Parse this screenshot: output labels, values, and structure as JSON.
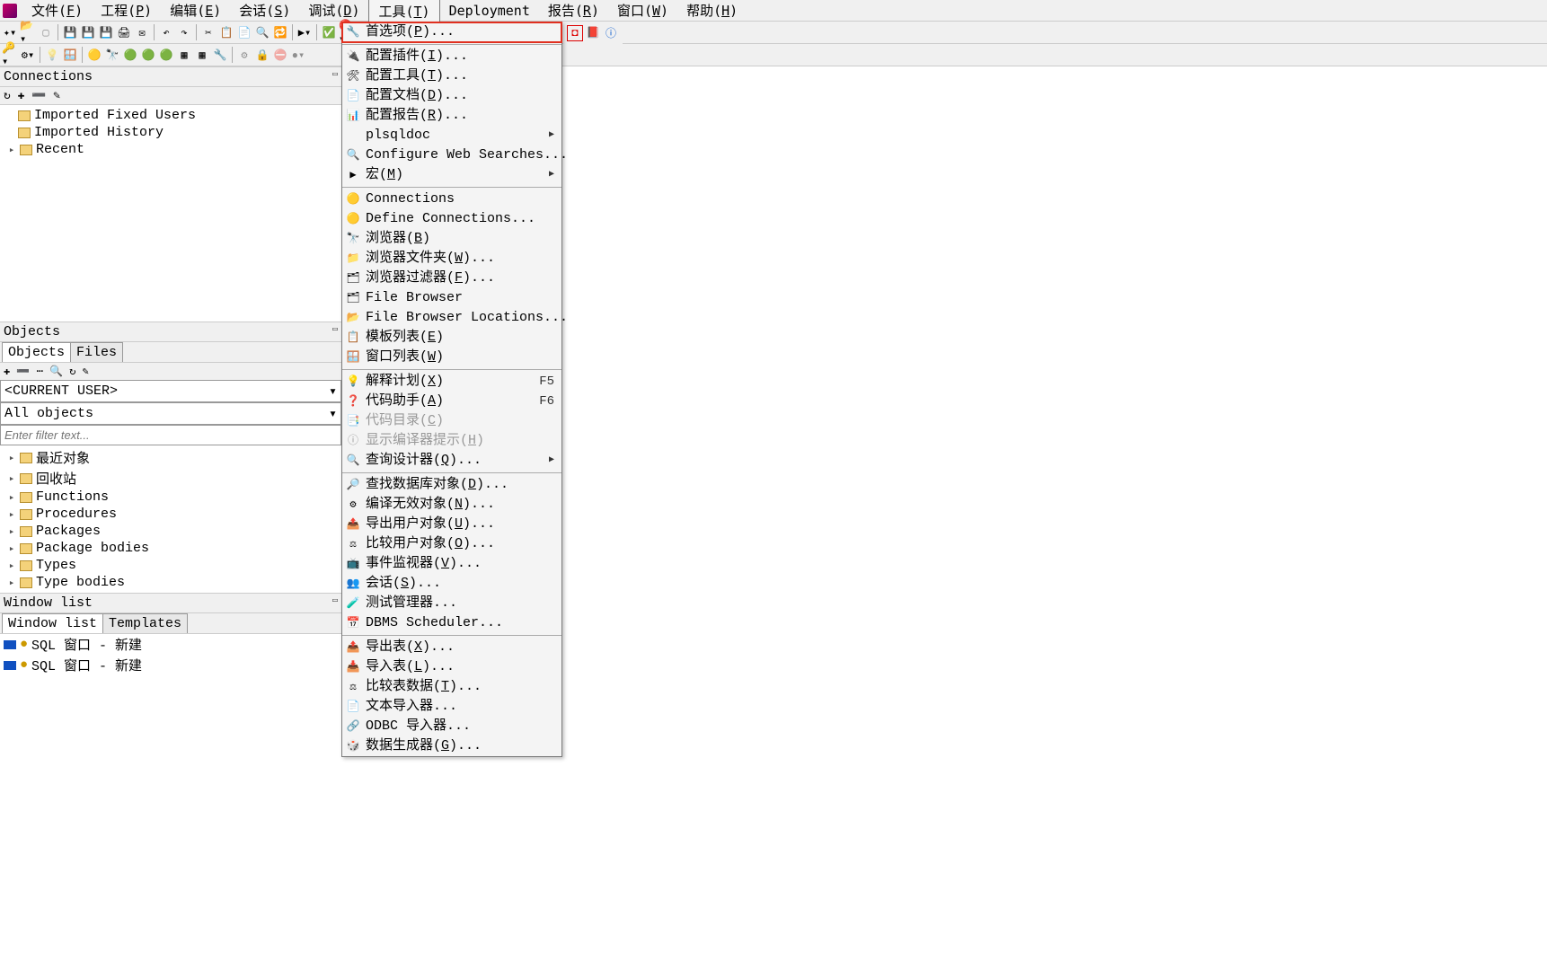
{
  "menubar": {
    "items": [
      {
        "label": "文件(F)"
      },
      {
        "label": "工程(P)"
      },
      {
        "label": "编辑(E)"
      },
      {
        "label": "会话(S)"
      },
      {
        "label": "调试(D)"
      },
      {
        "label": "工具(T)"
      },
      {
        "label": "Deployment"
      },
      {
        "label": "报告(R)"
      },
      {
        "label": "窗口(W)"
      },
      {
        "label": "帮助(H)"
      }
    ],
    "active_index": 5
  },
  "tools_menu": [
    {
      "icon": "🔧",
      "label": "首选项(P)...",
      "highlight": true
    },
    {
      "sep": true
    },
    {
      "icon": "🔌",
      "label": "配置插件(I)..."
    },
    {
      "icon": "🛠",
      "label": "配置工具(T)..."
    },
    {
      "icon": "📄",
      "label": "配置文档(D)..."
    },
    {
      "icon": "📊",
      "label": "配置报告(R)..."
    },
    {
      "icon": "",
      "label": "plsqldoc",
      "submenu": true
    },
    {
      "icon": "🔍",
      "label": "Configure Web Searches..."
    },
    {
      "icon": "▶",
      "label": "宏(M)",
      "submenu": true
    },
    {
      "sep": true
    },
    {
      "icon": "🟡",
      "label": "Connections"
    },
    {
      "icon": "🟡",
      "label": "Define Connections..."
    },
    {
      "icon": "🔭",
      "label": "浏览器(B)"
    },
    {
      "icon": "📁",
      "label": "浏览器文件夹(W)..."
    },
    {
      "icon": "🗂",
      "label": "浏览器过滤器(F)..."
    },
    {
      "icon": "🗂",
      "label": "File Browser"
    },
    {
      "icon": "📂",
      "label": "File Browser Locations..."
    },
    {
      "icon": "📋",
      "label": "模板列表(E)"
    },
    {
      "icon": "🪟",
      "label": "窗口列表(W)"
    },
    {
      "sep": true
    },
    {
      "icon": "💡",
      "label": "解释计划(X)",
      "shortcut": "F5"
    },
    {
      "icon": "❓",
      "label": "代码助手(A)",
      "shortcut": "F6"
    },
    {
      "icon": "📑",
      "label": "代码目录(C)",
      "disabled": true
    },
    {
      "icon": "ⓘ",
      "label": "显示编译器提示(H)",
      "disabled": true
    },
    {
      "icon": "🔍",
      "label": "查询设计器(Q)...",
      "submenu": true
    },
    {
      "sep": true
    },
    {
      "icon": "🔎",
      "label": "查找数据库对象(D)..."
    },
    {
      "icon": "⚙",
      "label": "编译无效对象(N)..."
    },
    {
      "icon": "📤",
      "label": "导出用户对象(U)..."
    },
    {
      "icon": "⚖",
      "label": "比较用户对象(O)..."
    },
    {
      "icon": "📺",
      "label": "事件监视器(V)..."
    },
    {
      "icon": "👥",
      "label": "会话(S)..."
    },
    {
      "icon": "🧪",
      "label": "测试管理器..."
    },
    {
      "icon": "📅",
      "label": "DBMS Scheduler..."
    },
    {
      "sep": true
    },
    {
      "icon": "📤",
      "label": "导出表(X)..."
    },
    {
      "icon": "📥",
      "label": "导入表(L)..."
    },
    {
      "icon": "⚖",
      "label": "比较表数据(T)..."
    },
    {
      "icon": "📄",
      "label": "文本导入器..."
    },
    {
      "icon": "🔗",
      "label": "ODBC 导入器..."
    },
    {
      "icon": "🎲",
      "label": "数据生成器(G)..."
    }
  ],
  "connections": {
    "title": "Connections",
    "toolbar": "↻ ✚ ➖ ✎",
    "items": [
      {
        "label": "Imported Fixed Users"
      },
      {
        "label": "Imported History"
      },
      {
        "label": "Recent",
        "expandable": true
      }
    ]
  },
  "objects": {
    "title": "Objects",
    "tabs": [
      "Objects",
      "Files"
    ],
    "mini_toolbar": "✚ ➖ ⋯ 🔍 ↻ ✎",
    "user_dropdown": "<CURRENT USER>",
    "filter_dropdown": "All objects",
    "filter_placeholder": "Enter filter text...",
    "tree": [
      "最近对象",
      "回收站",
      "Functions",
      "Procedures",
      "Packages",
      "Package bodies",
      "Types",
      "Type bodies"
    ]
  },
  "window_list": {
    "title": "Window list",
    "tabs": [
      "Window list",
      "Templates"
    ],
    "items": [
      "SQL 窗口 - 新建",
      "SQL 窗口 - 新建"
    ]
  },
  "toolbar_continue_icons": [
    "◘",
    "📕",
    "ⓘ"
  ]
}
